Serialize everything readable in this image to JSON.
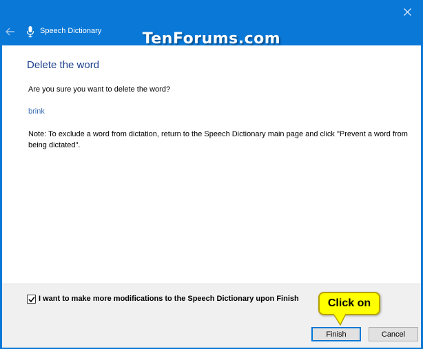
{
  "window": {
    "app_title": "Speech Dictionary",
    "watermark": "TenForums.com",
    "accent_color": "#0a78d7"
  },
  "icons": {
    "back": "back-arrow-icon",
    "mic": "microphone-icon",
    "close": "close-icon",
    "check": "checkmark-icon"
  },
  "page": {
    "heading": "Delete the word",
    "question": "Are you sure you want to delete the word?",
    "word": "brink",
    "note": "Note:  To exclude a word from dictation, return to the Speech Dictionary main page and click \"Prevent a word from being dictated\"."
  },
  "footer": {
    "checkbox_label": "I want to make more modifications to the Speech Dictionary upon Finish",
    "checkbox_checked": true,
    "finish_label": "Finish",
    "cancel_label": "Cancel"
  },
  "annotation": {
    "callout_text": "Click on"
  }
}
